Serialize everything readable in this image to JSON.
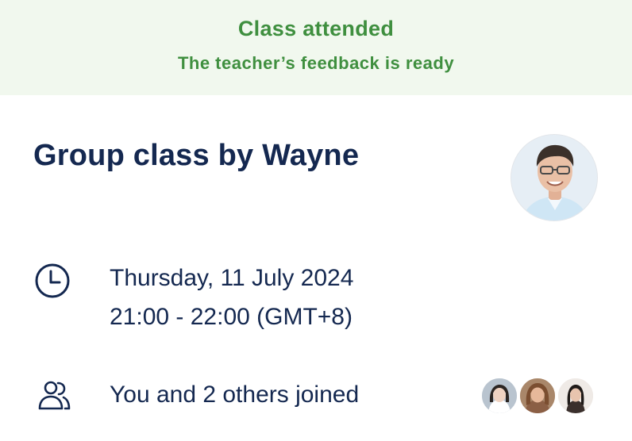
{
  "banner": {
    "title": "Class attended",
    "subtitle": "The teacher’s feedback is ready"
  },
  "class": {
    "title": "Group class by Wayne"
  },
  "schedule": {
    "date": "Thursday, 11 July 2024",
    "time": "21:00 - 22:00 (GMT+8)"
  },
  "participants": {
    "text": "You and 2 others joined",
    "avatars": [
      "participant-1",
      "participant-2",
      "participant-3"
    ]
  },
  "icons": {
    "clock": "clock-icon",
    "people": "people-icon"
  },
  "colors": {
    "banner_bg": "#f1f8ee",
    "banner_text": "#3f8f3f",
    "primary_text": "#142850"
  }
}
